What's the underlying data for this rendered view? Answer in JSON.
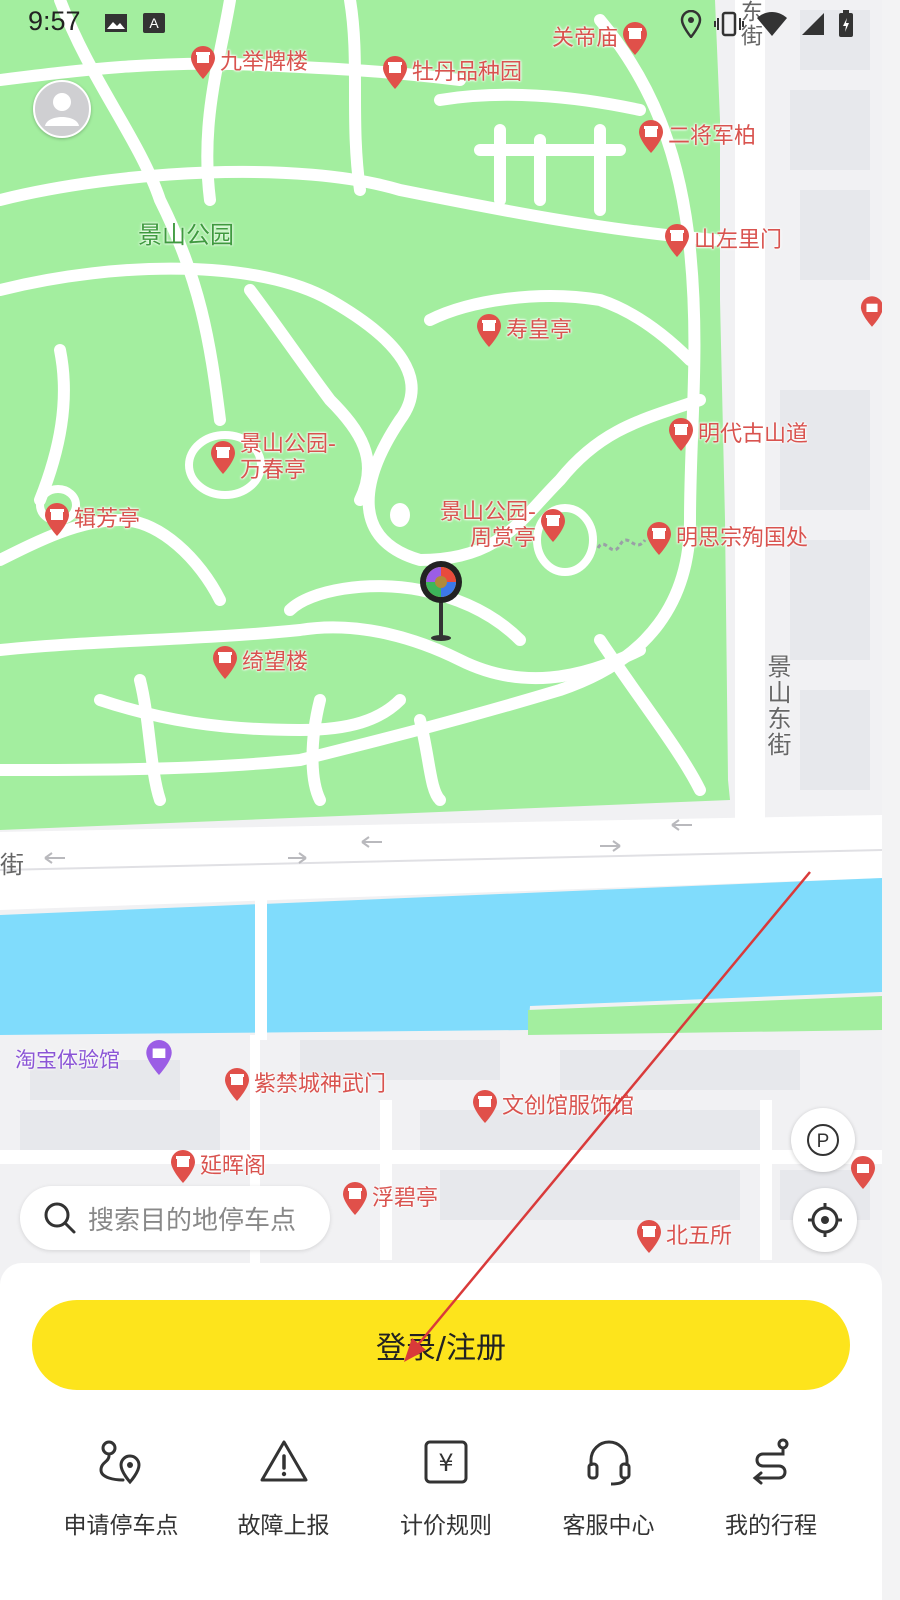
{
  "status_bar": {
    "time": "9:57",
    "icons": [
      "image-icon",
      "text-a-icon",
      "location-icon",
      "vibrate-icon",
      "wifi-icon",
      "signal-icon",
      "battery-icon"
    ]
  },
  "map": {
    "area_labels": {
      "jingshan_park": "景山公园"
    },
    "pois": {
      "jiujupailou": "九举牌楼",
      "mudanpinzhongyuan": "牡丹品种园",
      "guandimiao": "关帝庙",
      "erjiangjunbai": "二将军柏",
      "shanzuolimen": "山左里门",
      "shouhuangting": "寿皇亭",
      "mingdaigushandao": "明代古山道",
      "wanchunting": "景山公园-万春亭",
      "jifangting": "辑芳亭",
      "zhoushangting": "景山公园-周赏亭",
      "mingsizong": "明思宗殉国处",
      "qiwanglou": "绮望楼",
      "shenwumen": "紫禁城神武门",
      "wenchuangguan": "文创馆服饰馆",
      "yanhuige": "延晖阁",
      "fubiting": "浮碧亭",
      "beiwusuo": "北五所"
    },
    "shop_label": "淘宝体验馆",
    "streets": {
      "jingshan_east": "景山东街",
      "top_right": "东街",
      "left": "街"
    }
  },
  "search": {
    "placeholder": "搜索目的地停车点"
  },
  "login_button": "登录/注册",
  "nav": [
    {
      "label": "申请停车点",
      "icon": "route-pin-icon"
    },
    {
      "label": "故障上报",
      "icon": "warning-icon"
    },
    {
      "label": "计价规则",
      "icon": "yen-icon"
    },
    {
      "label": "客服中心",
      "icon": "headset-icon"
    },
    {
      "label": "我的行程",
      "icon": "trip-icon"
    }
  ],
  "colors": {
    "park_green": "#a3ee9f",
    "water_blue": "#80dcfc",
    "accent_yellow": "#fde41c",
    "poi_red": "#d9534f",
    "annotation_arrow": "#d93a3a"
  }
}
